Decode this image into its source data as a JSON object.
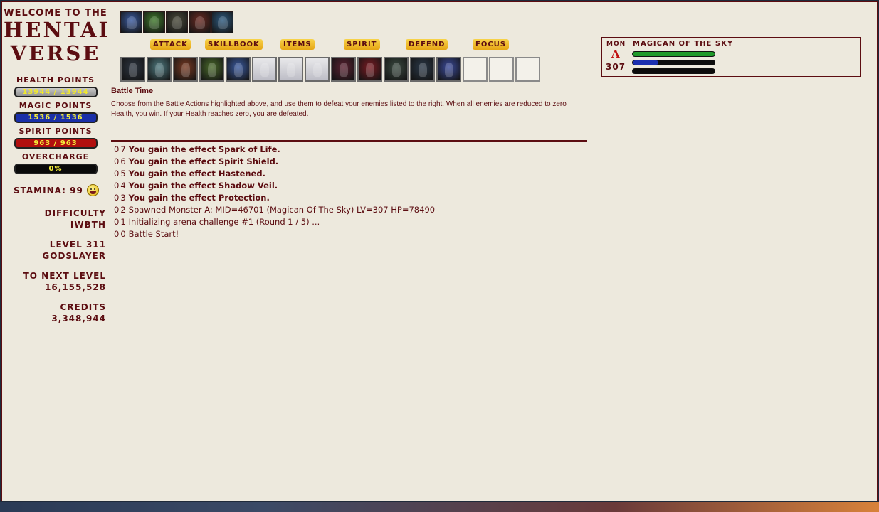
{
  "sidebar": {
    "welcome": "WELCOME TO THE",
    "logo_line1": "HENTAI",
    "logo_line2": "VERSE",
    "health_label": "HEALTH POINTS",
    "health_value": "13944 / 13944",
    "magic_label": "MAGIC POINTS",
    "magic_value": "1536 / 1536",
    "spirit_label": "SPIRIT POINTS",
    "spirit_value": "963 / 963",
    "overcharge_label": "OVERCHARGE",
    "overcharge_value": "0%",
    "stamina_text": "STAMINA: 99",
    "difficulty_label": "DIFFICULTY",
    "difficulty_value": "IWBTH",
    "level_label": "LEVEL 311",
    "level_title": "GODSLAYER",
    "next_label": "TO NEXT LEVEL",
    "next_value": "16,155,528",
    "credits_label": "CREDITS",
    "credits_value": "3,348,944"
  },
  "tabs": [
    "ATTACK",
    "SKILLBOOK",
    "ITEMS",
    "SPIRIT",
    "DEFEND",
    "FOCUS"
  ],
  "quickbar_icons": [
    {
      "name": "lightning-burst-icon",
      "color": "#3a5aa0"
    },
    {
      "name": "green-leaf-icon",
      "color": "#3f7a2a"
    },
    {
      "name": "dark-warrior-icon",
      "color": "#4a4a3a"
    },
    {
      "name": "red-fighter-icon",
      "color": "#6a2a22"
    },
    {
      "name": "blue-mage-icon",
      "color": "#2d5a80"
    }
  ],
  "action_slots": [
    {
      "name": "shadow-knight-icon",
      "color": "#2c3440",
      "kind": "filled"
    },
    {
      "name": "ice-spirit-icon",
      "color": "#4f7a80",
      "kind": "filled"
    },
    {
      "name": "flame-warrior-icon",
      "color": "#7a3a22",
      "kind": "filled"
    },
    {
      "name": "forest-druid-icon",
      "color": "#4a6a2a",
      "kind": "filled"
    },
    {
      "name": "lightning-mage-icon",
      "color": "#3a5aa0",
      "kind": "filled"
    },
    {
      "name": "ghost-figure-icon",
      "color": "#cfcfd6",
      "kind": "ghost"
    },
    {
      "name": "ghost-figure-icon",
      "color": "#cfcfd6",
      "kind": "ghost"
    },
    {
      "name": "ghost-figure-icon",
      "color": "#cfcfd6",
      "kind": "ghost"
    },
    {
      "name": "eye-orb-icon",
      "color": "#5a2030",
      "kind": "filled"
    },
    {
      "name": "crimson-beast-icon",
      "color": "#7a1a22",
      "kind": "filled"
    },
    {
      "name": "hooded-rogue-icon",
      "color": "#3a4a40",
      "kind": "filled"
    },
    {
      "name": "dark-sorceress-icon",
      "color": "#2a3848",
      "kind": "filled"
    },
    {
      "name": "lightning-burst-icon",
      "color": "#3a4a9a",
      "kind": "filled"
    },
    {
      "name": "empty-slot",
      "color": "#f3f1ea",
      "kind": "empty"
    },
    {
      "name": "empty-slot",
      "color": "#f3f1ea",
      "kind": "empty"
    },
    {
      "name": "empty-slot",
      "color": "#f3f1ea",
      "kind": "empty"
    }
  ],
  "battle": {
    "title": "Battle Time",
    "description": "Choose from the Battle Actions highlighted above, and use them to defeat your enemies listed to the right. When all enemies are reduced to zero Health, you win. If your Health reaches zero, you are defeated."
  },
  "log": [
    {
      "num": "07",
      "text": "You gain the effect Spark of Life.",
      "bold": true
    },
    {
      "num": "06",
      "text": "You gain the effect Spirit Shield.",
      "bold": true
    },
    {
      "num": "05",
      "text": "You gain the effect Hastened.",
      "bold": true
    },
    {
      "num": "04",
      "text": "You gain the effect Shadow Veil.",
      "bold": true
    },
    {
      "num": "03",
      "text": "You gain the effect Protection.",
      "bold": true
    },
    {
      "num": "02",
      "text": "Spawned Monster A: MID=46701 (Magican Of The Sky) LV=307 HP=78490",
      "bold": false
    },
    {
      "num": "01",
      "text": "Initializing arena challenge #1 (Round 1 / 5) ...",
      "bold": false
    },
    {
      "num": "00",
      "text": "Battle Start!",
      "bold": false
    }
  ],
  "monster": {
    "tag": "MON",
    "letter": "A",
    "level": "307",
    "name": "MAGICAN OF THE SKY",
    "hp_fraction": 1.0,
    "mp_fraction": 0.31,
    "sp_fraction": 0.0,
    "hp_color": "#1f9a2a",
    "mp_color": "#1a2fb0",
    "sp_color": "#b10f0f"
  }
}
